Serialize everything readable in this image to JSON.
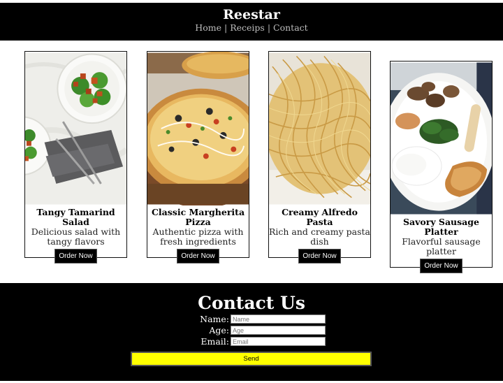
{
  "site": {
    "title": "Reestar",
    "nav": [
      {
        "label": "Home"
      },
      {
        "label": "Receips"
      },
      {
        "label": "Contact"
      }
    ],
    "nav_separator": "|"
  },
  "cards": [
    {
      "title": "Tangy Tamarind Salad",
      "description": "Delicious salad with tangy flavors",
      "button": "Order Now",
      "image": "salad-photo"
    },
    {
      "title": "Classic Margherita Pizza",
      "description": "Authentic pizza with fresh ingredients",
      "button": "Order Now",
      "image": "pizza-photo"
    },
    {
      "title": "Creamy Alfredo Pasta",
      "description": "Rich and creamy pasta dish",
      "button": "Order Now",
      "image": "pasta-photo"
    },
    {
      "title": "Savory Sausage Platter",
      "description": "Flavorful sausage platter",
      "button": "Order Now",
      "image": "sausage-platter-photo"
    }
  ],
  "contact": {
    "heading": "Contact Us",
    "name_label": "Name:",
    "name_placeholder": "Name",
    "age_label": "Age:",
    "age_placeholder": "Age",
    "email_label": "Email:",
    "email_placeholder": "Email",
    "send_label": "Send"
  },
  "colors": {
    "header_bg": "#000000",
    "footer_bg": "#000000",
    "send_button": "#ffff00",
    "nav_text": "#bdbdbd"
  }
}
